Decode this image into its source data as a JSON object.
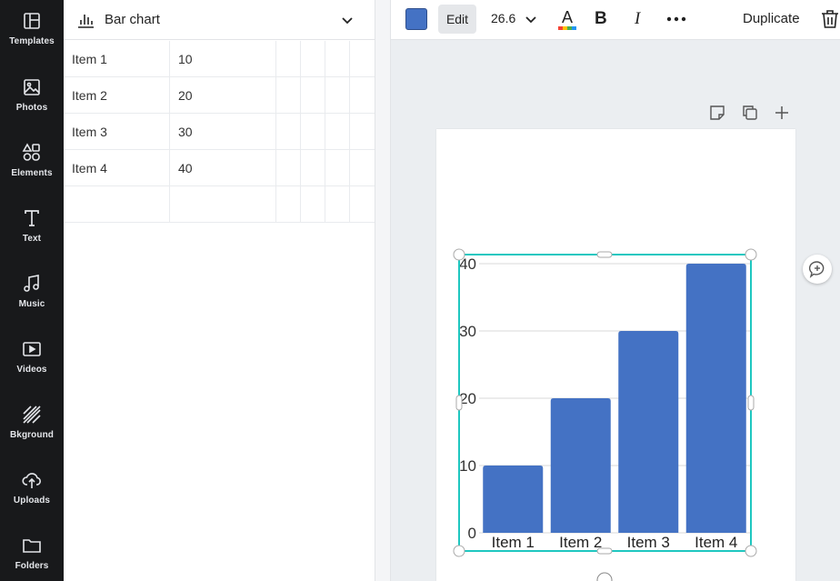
{
  "sidebar": {
    "items": [
      {
        "label": "Templates",
        "icon": "templates-icon"
      },
      {
        "label": "Photos",
        "icon": "photos-icon"
      },
      {
        "label": "Elements",
        "icon": "elements-icon"
      },
      {
        "label": "Text",
        "icon": "text-icon"
      },
      {
        "label": "Music",
        "icon": "music-icon"
      },
      {
        "label": "Videos",
        "icon": "videos-icon"
      },
      {
        "label": "Bkground",
        "icon": "background-icon"
      },
      {
        "label": "Uploads",
        "icon": "uploads-icon"
      },
      {
        "label": "Folders",
        "icon": "folders-icon"
      }
    ]
  },
  "panel": {
    "chart_type": "Bar chart",
    "rows": [
      [
        "Item 1",
        "10"
      ],
      [
        "Item 2",
        "20"
      ],
      [
        "Item 3",
        "30"
      ],
      [
        "Item 4",
        "40"
      ],
      [
        "",
        ""
      ]
    ]
  },
  "toolbar": {
    "color": "#4472c4",
    "edit_label": "Edit",
    "font_size": "26.6",
    "bold_label": "B",
    "italic_label": "I",
    "duplicate_label": "Duplicate"
  },
  "chart_data": {
    "type": "bar",
    "categories": [
      "Item 1",
      "Item 2",
      "Item 3",
      "Item 4"
    ],
    "values": [
      10,
      20,
      30,
      40
    ],
    "yticks": [
      "0",
      "10",
      "20",
      "30",
      "40"
    ],
    "ylim": [
      0,
      40
    ],
    "grid": true,
    "bar_color": "#4472c4",
    "title": "",
    "xlabel": "",
    "ylabel": ""
  },
  "colors": {
    "selection": "#1fc7c0",
    "rail": "#18191b"
  }
}
